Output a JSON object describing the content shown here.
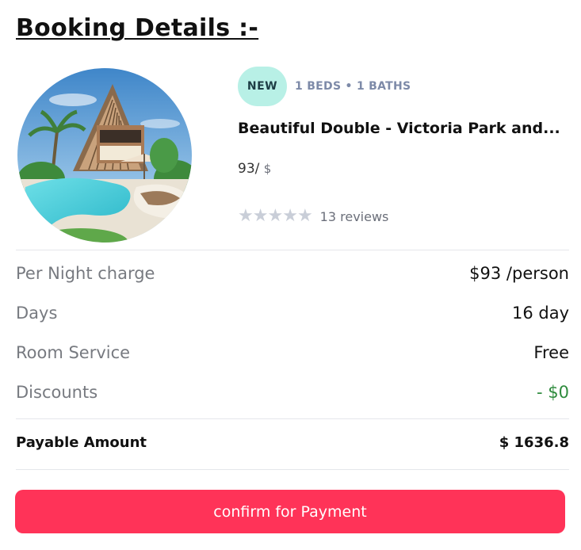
{
  "page": {
    "heading": "Booking Details :-"
  },
  "room": {
    "badge": "NEW",
    "meta": "1 BEDS • 1 BATHS",
    "title": "Beautiful Double - Victoria Park and...",
    "price_value": "93/",
    "price_currency": "$",
    "rating": {
      "stars_filled": 0,
      "stars_total": 5
    },
    "reviews": "13 reviews"
  },
  "charges": [
    {
      "label": "Per Night charge",
      "value": "$93 /person"
    },
    {
      "label": "Days",
      "value": "16 day"
    },
    {
      "label": "Room Service",
      "value": "Free"
    },
    {
      "label": "Discounts",
      "value": "- $0"
    }
  ],
  "total": {
    "label": "Payable Amount",
    "value": "$ 1636.8"
  },
  "actions": {
    "confirm_label": "confirm for Payment"
  },
  "colors": {
    "accent": "#ff3358",
    "badge_bg": "#b8f0e6",
    "discount": "#2e8b3d",
    "star_empty": "#c9ced8"
  },
  "icons": {
    "star": "star-icon"
  }
}
